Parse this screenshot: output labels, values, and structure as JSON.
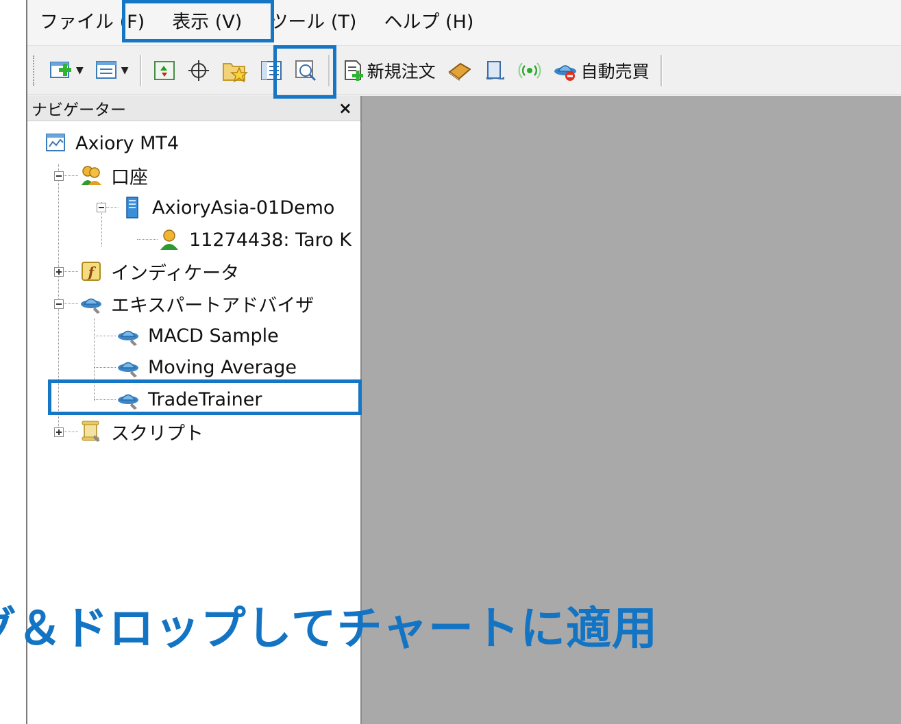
{
  "menu": {
    "items": [
      {
        "label": "ファイル (F)"
      },
      {
        "label": "表示 (V)"
      },
      {
        "label": "ツール (T)"
      },
      {
        "label": "ヘルプ (H)"
      }
    ]
  },
  "toolbar": {
    "new_order_label": "新規注文",
    "auto_trade_label": "自動売買"
  },
  "navigator": {
    "title": "ナビゲーター",
    "close_glyph": "×",
    "root": "Axiory MT4",
    "accounts": "口座",
    "server": "AxioryAsia-01Demo",
    "account": "11274438: Taro K",
    "indicators": "インディケータ",
    "expert_advisors": "エキスパートアドバイザ",
    "ea_items": [
      "MACD Sample",
      "Moving Average",
      "TradeTrainer"
    ],
    "scripts": "スクリプト"
  },
  "annotation": {
    "instruction": "ドラッグ＆ドロップしてチャートに適用"
  },
  "colors": {
    "highlight": "#1676c6",
    "instruction_text": "#1474c4",
    "chart_background": "#a9a9a9"
  }
}
